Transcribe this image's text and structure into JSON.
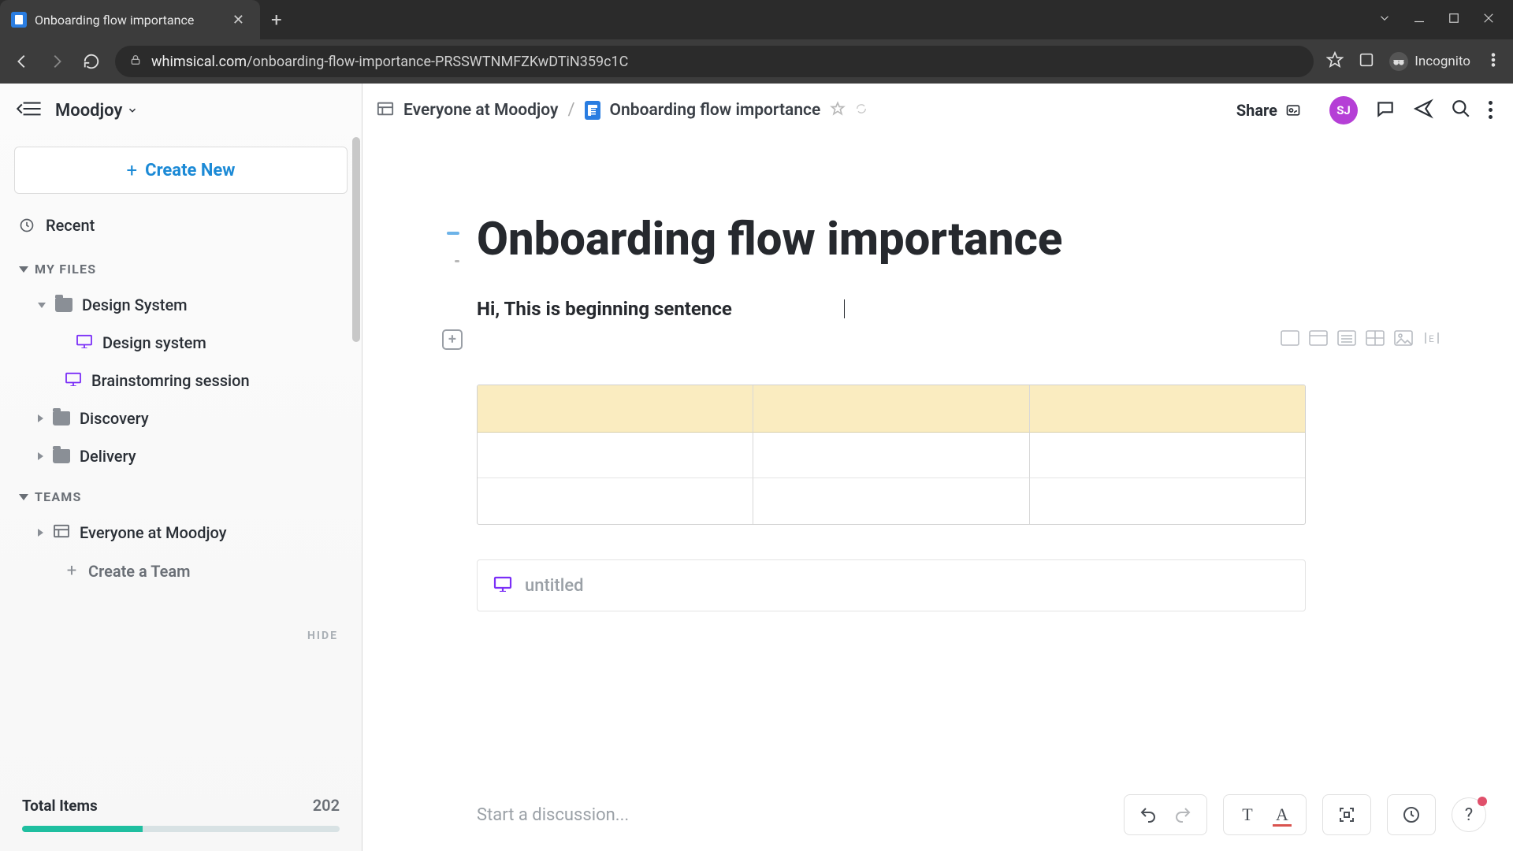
{
  "browser": {
    "tab_title": "Onboarding flow importance",
    "url_domain": "whimsical.com",
    "url_path": "/onboarding-flow-importance-PRSSWTNMFZKwDTiN359c1C",
    "incognito_label": "Incognito"
  },
  "sidebar": {
    "workspace": "Moodjoy",
    "create_new": "Create New",
    "recent": "Recent",
    "sections": {
      "my_files": "MY FILES",
      "teams": "TEAMS"
    },
    "my_files": [
      {
        "label": "Design System",
        "type": "folder",
        "expanded": true
      },
      {
        "label": "Design system",
        "type": "presentation",
        "nested": true
      },
      {
        "label": "Brainstomring session",
        "type": "presentation",
        "nested": true
      },
      {
        "label": "Discovery",
        "type": "folder",
        "expanded": false
      },
      {
        "label": "Delivery",
        "type": "folder",
        "expanded": false
      }
    ],
    "teams": [
      {
        "label": "Everyone at Moodjoy"
      }
    ],
    "create_team": "Create a Team",
    "hide": "HIDE",
    "total_label": "Total Items",
    "total_count": "202",
    "progress_pct": 38
  },
  "header": {
    "breadcrumb_team": "Everyone at Moodjoy",
    "breadcrumb_doc": "Onboarding flow importance",
    "share": "Share",
    "avatar": "SJ"
  },
  "document": {
    "title": "Onboarding flow importance",
    "first_line": "Hi, This is beginning sentence",
    "embed_label": "untitled"
  },
  "bottombar": {
    "discussion_placeholder": "Start a discussion...",
    "text_tool": "T",
    "style_tool": "A"
  }
}
